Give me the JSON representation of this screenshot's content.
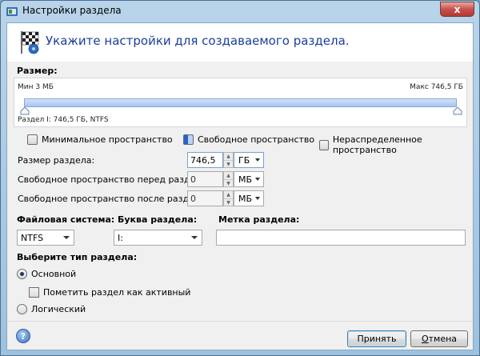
{
  "window": {
    "title": "Настройки раздела",
    "close_glyph": "x"
  },
  "header": {
    "heading": "Укажите настройки для создаваемого раздела."
  },
  "size": {
    "section_label": "Размер:",
    "min_label": "Мин 3 МБ",
    "max_label": "Макс 746,5 ГБ",
    "partition_label": "Раздел I: 746,5 ГБ, NTFS",
    "fill_fraction": 1.0
  },
  "legend": {
    "minimal": "Минимальное пространство",
    "free": "Свободное пространство",
    "unallocated": "Нераспределенное пространство"
  },
  "fields": {
    "partition_size": {
      "label": "Размер раздела:",
      "value": "746,5",
      "unit": "ГБ"
    },
    "space_before": {
      "label": "Свободное пространство перед разделом:",
      "value": "0",
      "unit": "МБ"
    },
    "space_after": {
      "label": "Свободное пространство после раздела:",
      "value": "0",
      "unit": "МБ"
    }
  },
  "filesystem": {
    "label": "Файловая система:",
    "value": "NTFS"
  },
  "drive_letter": {
    "label": "Буква раздела:",
    "value": "I:"
  },
  "volume_label": {
    "label": "Метка раздела:",
    "value": ""
  },
  "partition_type": {
    "label": "Выберите тип раздела:",
    "primary": "Основной",
    "mark_active": "Пометить раздел как активный",
    "logical": "Логический"
  },
  "footer": {
    "help_glyph": "?",
    "ok_label": "Принять",
    "cancel_label_first": "О",
    "cancel_label_rest": "тмена"
  }
}
